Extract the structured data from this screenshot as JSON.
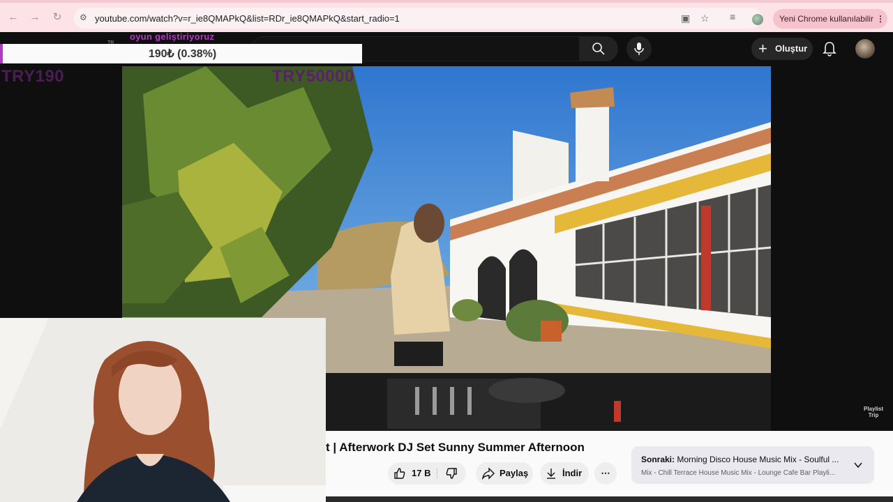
{
  "browser": {
    "url": "youtube.com/watch?v=r_ie8QMAPkQ&list=RDr_ie8QMAPkQ&start_radio=1",
    "update_label": "Yeni Chrome kullanılabilir"
  },
  "youtube": {
    "create_label": "Oluştur"
  },
  "stream_overlay": {
    "top_text": "oyun geliştiriyoruz",
    "tr_label": "TR",
    "donation_text": "190₺ (0.38%)",
    "donation_progress": 0.0038,
    "goal_start": "TRY190",
    "goal_end": "TRY50000",
    "accent_color": "#b638c8"
  },
  "video": {
    "title_fragment": "t | Afterwork DJ Set Sunny Summer Afternoon",
    "watermark": "Playlist Trip",
    "likes": "17 B",
    "share_label": "Paylaş",
    "download_label": "İndir"
  },
  "up_next": {
    "prefix": "Sonraki:",
    "title": "Morning Disco House Music Mix - Soulful ...",
    "subtitle": "Mix - Chill Terrace House Music Mix - Lounge Cafe Bar Playli..."
  }
}
